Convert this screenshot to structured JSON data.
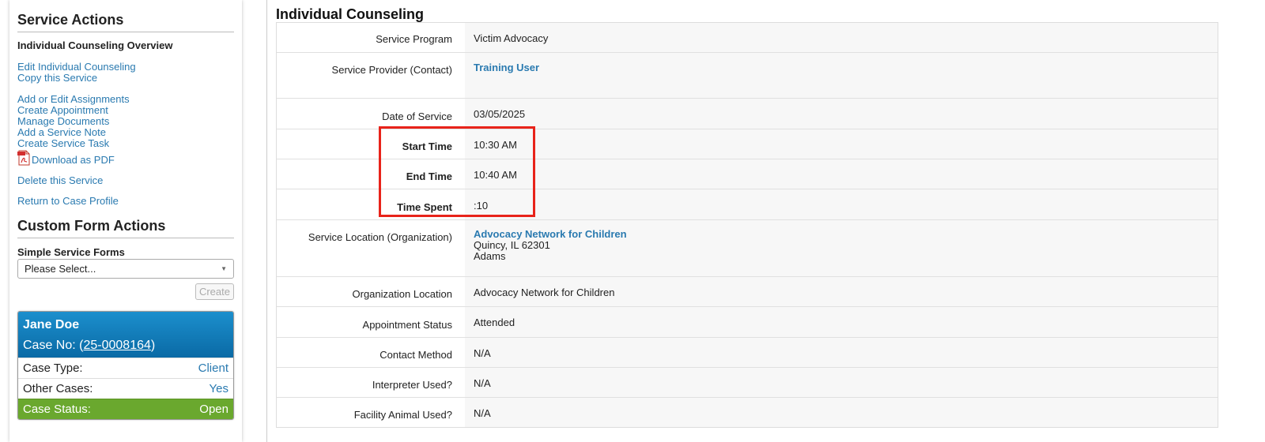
{
  "sidebar": {
    "service_actions_heading": "Service Actions",
    "overview_label": "Individual Counseling Overview",
    "links_group1": [
      "Edit Individual Counseling",
      "Copy this Service"
    ],
    "links_group2": [
      "Add or Edit Assignments",
      "Create Appointment",
      "Manage Documents",
      "Add a Service Note",
      "Create Service Task"
    ],
    "download_pdf": "Download as PDF",
    "delete_service": "Delete this Service",
    "return_profile": "Return to Case Profile",
    "custom_form_heading": "Custom Form Actions",
    "simple_forms_label": "Simple Service Forms",
    "select_value": "Please Select...",
    "create_button": "Create"
  },
  "case_card": {
    "name": "Jane Doe",
    "case_no_label": "Case No: (",
    "case_no": "25-0008164",
    "case_no_close": ")",
    "rows": [
      {
        "label": "Case Type:",
        "value": "Client"
      },
      {
        "label": "Other Cases:",
        "value": "Yes"
      }
    ],
    "status": {
      "label": "Case Status:",
      "value": "Open"
    }
  },
  "main": {
    "title": "Individual Counseling",
    "service_program": {
      "label": "Service Program",
      "value": "Victim Advocacy"
    },
    "service_provider": {
      "label": "Service Provider (Contact)",
      "value": "Training User"
    },
    "date_of_service": {
      "label": "Date of Service",
      "value": "03/05/2025"
    },
    "start_time": {
      "label": "Start Time",
      "value": "10:30 AM"
    },
    "end_time": {
      "label": "End Time",
      "value": "10:40 AM"
    },
    "time_spent": {
      "label": "Time Spent",
      "value": ":10"
    },
    "service_location": {
      "label": "Service Location (Organization)",
      "name": "Advocacy Network for Children",
      "city": "Quincy, IL 62301",
      "county": "Adams"
    },
    "organization_location": {
      "label": "Organization Location",
      "value": "Advocacy Network for Children"
    },
    "appointment_status": {
      "label": "Appointment Status",
      "value": "Attended"
    },
    "contact_method": {
      "label": "Contact Method",
      "value": "N/A"
    },
    "interpreter_used": {
      "label": "Interpreter Used?",
      "value": "N/A"
    },
    "facility_animal": {
      "label": "Facility Animal Used?",
      "value": "N/A"
    }
  },
  "colors": {
    "link": "#2a7ab0",
    "card_header": "#0a6aa5",
    "status_green": "#6aa82e",
    "highlight": "#e8231a"
  },
  "icons": {
    "pdf": "pdf-icon",
    "dropdown": "chevron-down-icon"
  }
}
